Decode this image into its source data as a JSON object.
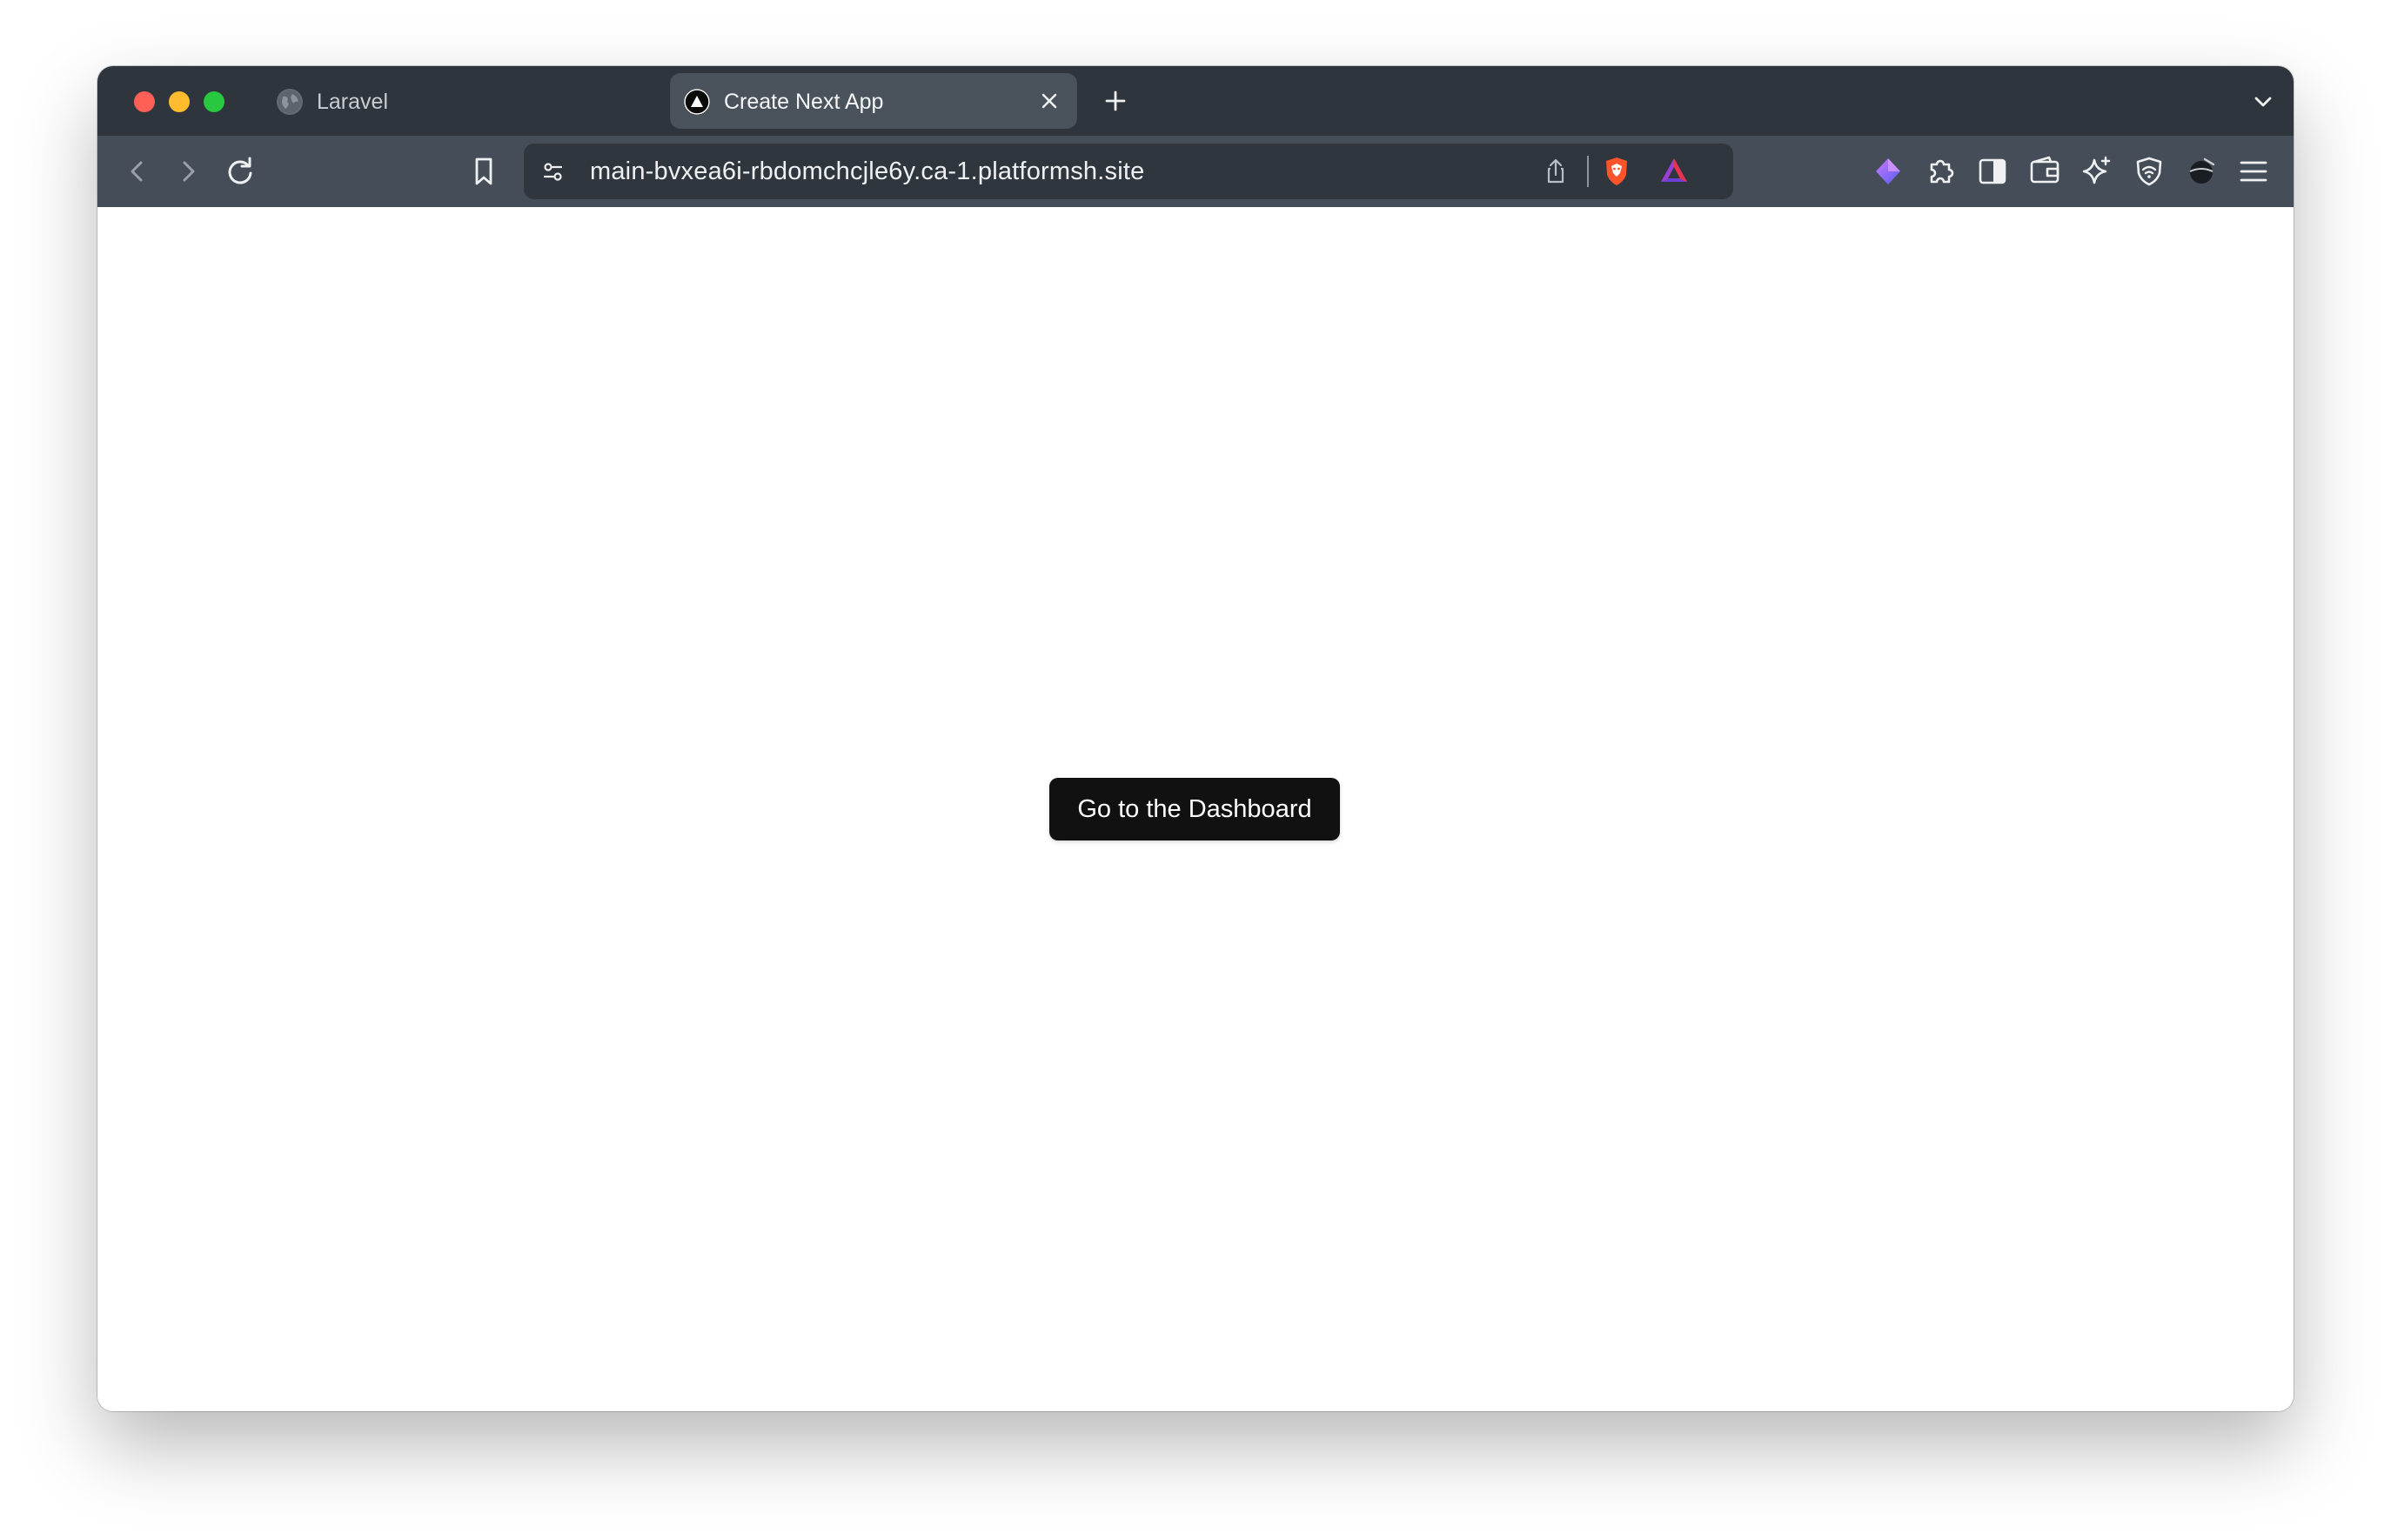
{
  "browser": {
    "tabs": [
      {
        "title": "Laravel",
        "active": false,
        "favicon": "globe-icon"
      },
      {
        "title": "Create Next App",
        "active": true,
        "favicon": "nextjs-triangle-icon"
      }
    ],
    "address": "main-bvxea6i-rbdomchcjle6y.ca-1.platformsh.site",
    "toolbar_icons": [
      "back-icon",
      "forward-icon",
      "reload-icon",
      "bookmark-icon",
      "site-settings-icon",
      "share-icon",
      "brave-shields-icon",
      "brave-rewards-icon",
      "leo-ai-icon",
      "extensions-icon",
      "sidebar-icon",
      "wallet-icon",
      "sparkle-icon",
      "vpn-icon",
      "profile-icon",
      "menu-icon"
    ],
    "colors": {
      "tabbar": "#2f353c",
      "toolbar": "#454e58",
      "urlbar": "#2f363d"
    }
  },
  "page": {
    "button_label": "Go to the Dashboard",
    "button_color": "#111111"
  }
}
